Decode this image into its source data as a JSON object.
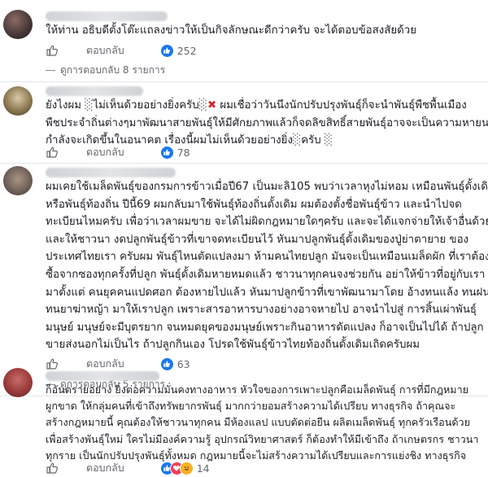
{
  "ui": {
    "reply_label": "ตอบกลับ",
    "see_replies_prefix": "ดูการตอบกลับ"
  },
  "comments": [
    {
      "text_lines": [
        "ให้ท่าน อธิบดีตั้งโต๊ะแถลงข่าวให้เป็นกิจลักษณะดีกว่าครับ จะได้ตอบข้อสงสัยด้วย"
      ],
      "reaction_count": "252",
      "replies_label": "ดูการตอบกลับ 8 รายการ"
    },
    {
      "text_lines": [
        "ยังไงผม ",
        "ไม่เห็นด้วยอย่างยิ่งครับ",
        "ผมเชื่อว่าวันนึงนักปรับปรุงพันธุ์ก็จะนำพันธุ์พืชพื้นเมือง",
        "พืชประจำถิ่นต่างๆมาพัฒนาสายพันธุ์ให้มีศักยภาพแล้วก็จดลิขสิทธิ์สายพันธุ์อาจจะเป็นความหายนะที่",
        "กำลังจะเกิดขึ้นในอนาคต เรื่องนี้ผมไม่เห็นด้วยอย่างยิ่ง",
        "ครับ"
      ],
      "reaction_count": "78"
    },
    {
      "text_lines": [
        "ผมเคยใช้เมล็ดพันธุ์ของกรมการข้าวเมื่อปี67 เป็นมะลิ105 พบว่าเวลาหุงไม่หอม เหมือนพันธุ์ดั้งเดิม",
        "หรือพันธุ์ท้องถิ่น ปีนี้69 ผมกลับมาใช้พันธุ์ท้องถิ่นดั้งเดิม ผมต้องตั้งชื่อพันธุ์ข้าว และนำไปจด",
        "ทะเบียนไหมครับ เพื่อว่าเวลาผมขาย จะได้ไม่ผิดกฎหมายใดๆครับ และจะได้แจกจ่ายให้เจ้าอื่นด้วย",
        "และให้ชาวนา งดปลูกพันธุ์ข้าวที่เขาจดทะเบียนไว้ หันมาปลูกพันธุ์ดั้งเดิมของปู่ย่าตายาย ของ",
        "ประเทศไทยเรา ครับผม พันธุ์ไหนตัดแปลงมา ห้ามคนไทยปลูก มันจะเป็นเหมือนเมล็ดผัก ที่เราต้อง",
        "ซื้อจากซองทุกครั้งที่ปลูก พันธุ์ดั้งเดิมหายหมดแล้ว ชาวนาทุกคนจงช่วยกัน อย่าให้ข้าวที่อยู่กับเรา",
        "มาตั้งแต่ คนยุคคนแปดศอก ต้องหายไปแล้ว หันมาปลูกข้าวที่เขาพัฒนามาโดย อ้างทนแล้ง ทนฝน",
        "ทนยาฆ่าหญ้า มาให้เราปลูก เพราะสารอาหารบางอย่างอาจหายไป อาจนำไปสู่ การสิ้นเผ่าพันธุ์",
        "มนุษย์ มนุษย์จะมีบุตรยาก จนหมดยุคของมนุษย์เพราะกินอาหารดัดแปลง ก็อาจเป็นไปได้ ถ้าปลูก",
        "ขายส่งนอกไม่เป็นไร ถ้าปลูกกินเอง โปรดใช้พันธุ์ข้าวไทยท้องถิ่นดั้งเดิมเถิดครับผม"
      ],
      "reaction_count": "63",
      "replies_label": "ดูการตอบกลับ 5 รายการ"
    },
    {
      "text_lines": [
        "ก็อันตรายอย่าง ยิ่งต่อความมั่นคงทางอาหาร หัวใจของการเพาะปลูกคือเมล็ดพันธุ์ การที่มีกฎหมาย",
        "ผูกขาด ให้กลุ่มคนที่เข้าถึงทรัพยากรพันธุ์ มากกว่ายอมสร้างความได้เปรียบ ทางธุรกิจ ถ้าคุณจะ",
        "สร้างกฎหมายนี้ คุณต้องให้ชาวนาทุกคน มีห้องแลป แบบตัดต่อยีน ผลิตเมล็ดพันธุ์ ทุกครัวเรือนด้วย",
        "เพื่อสร้างพันธุ์ใหม่ ใครไม่มีองค์ความรู้ อุปกรณ์วิทยาศาสตร์ ก็ต้องทำให้มีเข้าถึง ถ้าเกษตรกร ชาวนา",
        "ทุกราย เป็นนักปรับปรุงพันธุ์ทั้งหมด กฎหมายนี้จะไม่สร้างความได้เปรียบและการแย่งชิง ทางธุรกิจ"
      ],
      "reaction_count": "14"
    }
  ],
  "colors": {
    "like_blue": "#1877f2",
    "love_red": "#f33e58",
    "haha_yellow": "#f7b125",
    "meta_gray": "#65676b",
    "text": "#1c1e21"
  }
}
